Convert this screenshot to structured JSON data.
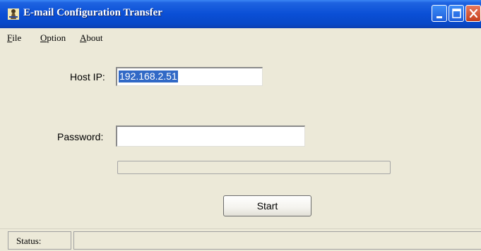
{
  "window": {
    "title": "E-mail Configuration Transfer",
    "icon": "app-icon"
  },
  "menu": {
    "file_first": "F",
    "file_rest": "ile",
    "option_first": "O",
    "option_rest": "ption",
    "about_first": "A",
    "about_rest": "bout"
  },
  "form": {
    "host_label": "Host IP:",
    "host_value": "192.168.2.51",
    "password_label": "Password:",
    "password_value": "",
    "progress": 0
  },
  "buttons": {
    "start_label": "Start"
  },
  "status": {
    "label": "Status:",
    "text": ""
  },
  "colors": {
    "titlebar": "#0a4fd6",
    "selection": "#3169c6",
    "background": "#ece9d8"
  }
}
